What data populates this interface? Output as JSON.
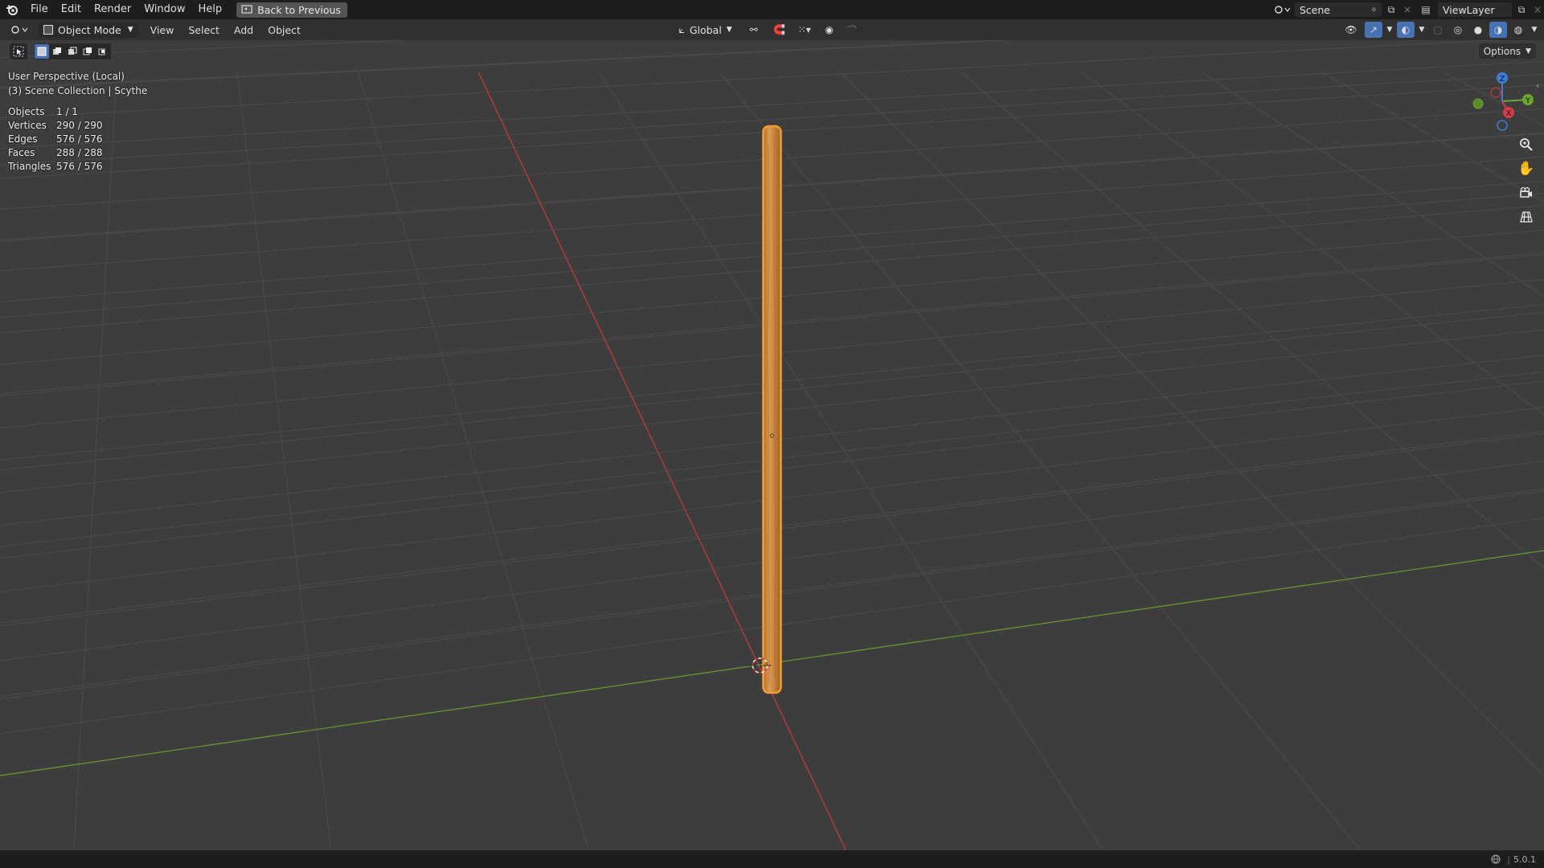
{
  "menubar": {
    "items": [
      "File",
      "Edit",
      "Render",
      "Window",
      "Help"
    ],
    "back_button": "Back to Previous",
    "scene": "Scene",
    "view_layer": "ViewLayer"
  },
  "header": {
    "mode": "Object Mode",
    "menus": [
      "View",
      "Select",
      "Add",
      "Object"
    ],
    "orientation": "Global",
    "options": "Options"
  },
  "viewport": {
    "view_name": "User Perspective (Local)",
    "collection": "(3) Scene Collection | Scythe",
    "stats": [
      {
        "label": "Objects",
        "value": "1 / 1"
      },
      {
        "label": "Vertices",
        "value": "290 / 290"
      },
      {
        "label": "Edges",
        "value": "576 / 576"
      },
      {
        "label": "Faces",
        "value": "288 / 288"
      },
      {
        "label": "Triangles",
        "value": "576 / 576"
      }
    ],
    "gizmo": {
      "z": "Z",
      "y": "Y",
      "x": "X"
    }
  },
  "statusbar": {
    "version": "5.0.1"
  },
  "colors": {
    "x_axis": "#c9393f",
    "y_axis": "#6a9a2c",
    "selection": "#f39c33",
    "accent": "#4772b3"
  }
}
